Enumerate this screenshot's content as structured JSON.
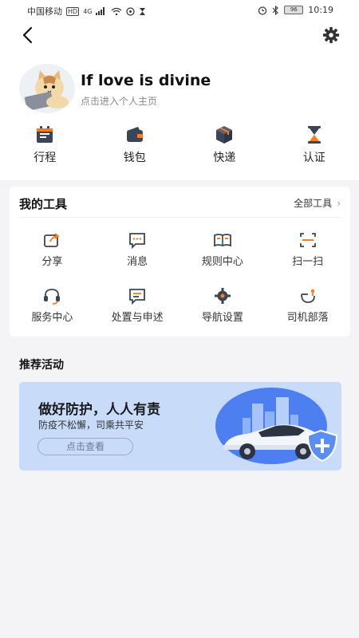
{
  "status_bar": {
    "carrier": "中国移动",
    "hd": "HD",
    "network": "4G",
    "battery": "96",
    "time": "10:19"
  },
  "profile": {
    "username": "If love is divine",
    "subtitle": "点击进入个人主页"
  },
  "quick_actions": [
    {
      "label": "行程",
      "icon": "calendar-icon"
    },
    {
      "label": "钱包",
      "icon": "wallet-icon"
    },
    {
      "label": "快递",
      "icon": "package-icon"
    },
    {
      "label": "认证",
      "icon": "hourglass-icon"
    }
  ],
  "tools": {
    "title": "我的工具",
    "all_label": "全部工具",
    "items": [
      {
        "label": "分享",
        "icon": "share-icon"
      },
      {
        "label": "消息",
        "icon": "message-icon"
      },
      {
        "label": "规则中心",
        "icon": "book-icon"
      },
      {
        "label": "扫一扫",
        "icon": "scan-icon"
      },
      {
        "label": "服务中心",
        "icon": "headset-icon"
      },
      {
        "label": "处置与申述",
        "icon": "appeal-icon"
      },
      {
        "label": "导航设置",
        "icon": "navigation-gear-icon"
      },
      {
        "label": "司机部落",
        "icon": "tribe-icon"
      }
    ]
  },
  "recommend": {
    "title": "推荐活动",
    "banner_title": "做好防护，人人有责",
    "banner_subtitle": "防疫不松懈，司乘共平安",
    "banner_button": "点击查看"
  },
  "colors": {
    "accent": "#ff7a1a",
    "icon_dark": "#3a4658",
    "banner_bg": "#c8dcfa"
  }
}
